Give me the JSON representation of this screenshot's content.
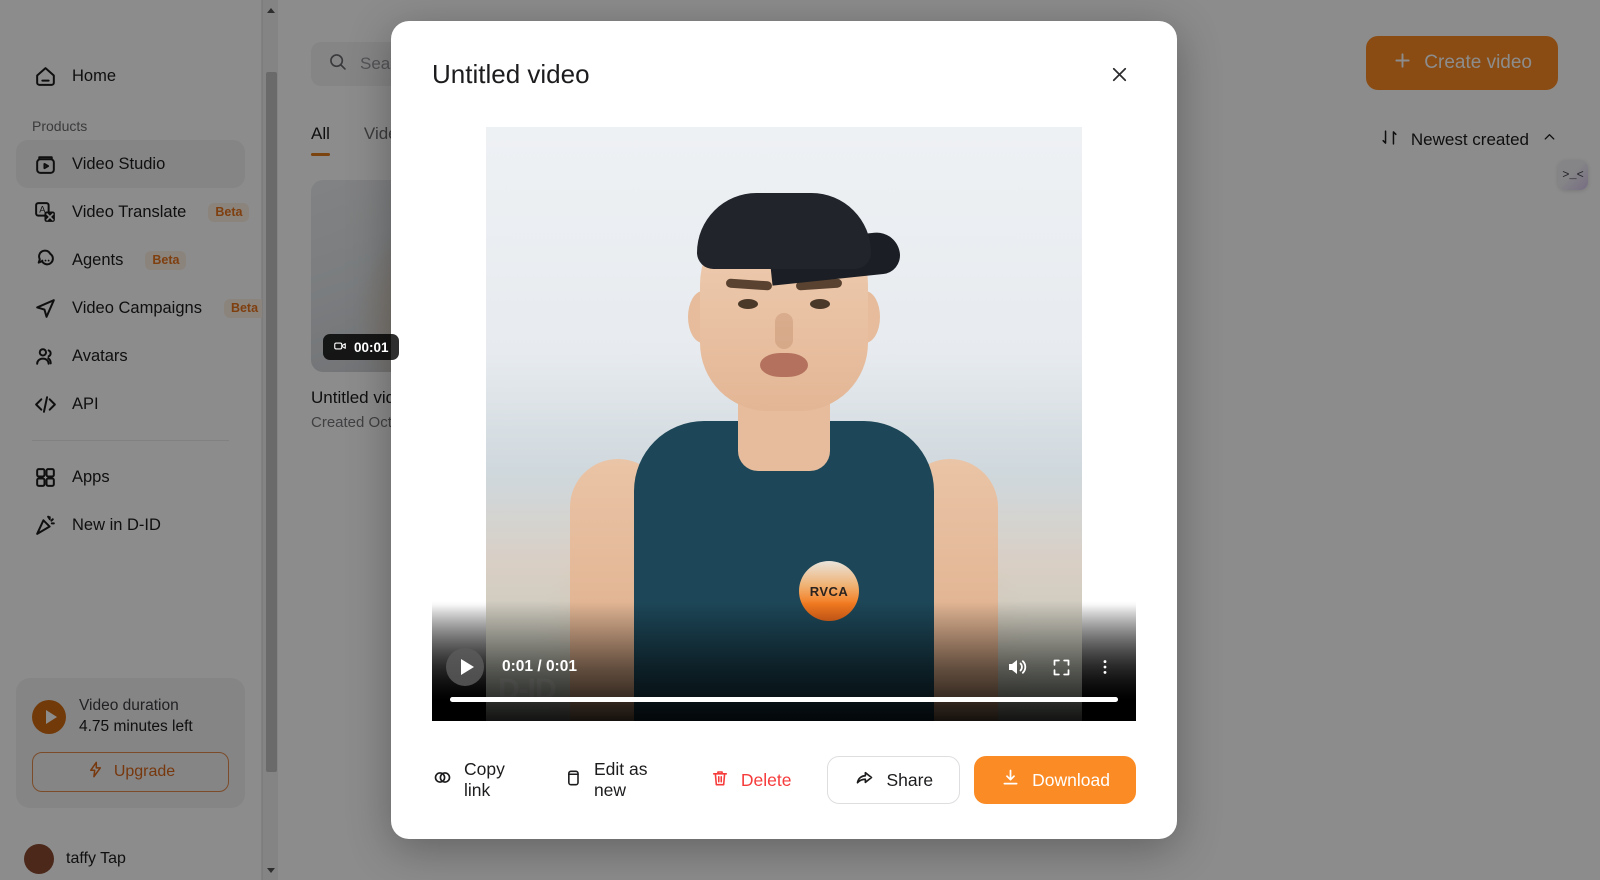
{
  "colors": {
    "accent": "#fb8b24",
    "accent_dark": "#cf6a12",
    "danger": "#f63b3b",
    "active_tab_underline": "#e07b18"
  },
  "sidebar": {
    "home": {
      "label": "Home",
      "icon": "home-icon"
    },
    "section_label": "Products",
    "items": [
      {
        "label": "Video Studio",
        "icon": "video-studio-icon",
        "badge": "",
        "active": true
      },
      {
        "label": "Video Translate",
        "icon": "video-translate-icon",
        "badge": "Beta",
        "active": false
      },
      {
        "label": "Agents",
        "icon": "agents-icon",
        "badge": "Beta",
        "active": false
      },
      {
        "label": "Video Campaigns",
        "icon": "video-campaigns-icon",
        "badge": "Beta",
        "active": false
      },
      {
        "label": "Avatars",
        "icon": "avatars-icon",
        "badge": "",
        "active": false
      },
      {
        "label": "API",
        "icon": "api-icon",
        "badge": "",
        "active": false
      }
    ],
    "items_after_divider": [
      {
        "label": "Apps",
        "icon": "apps-icon",
        "badge": ""
      },
      {
        "label": "New in D-ID",
        "icon": "confetti-icon",
        "badge": ""
      }
    ],
    "usage": {
      "title": "Video duration",
      "remaining": "4.75 minutes left",
      "upgrade_label": "Upgrade"
    },
    "user": {
      "name": "taffy Tap"
    }
  },
  "main": {
    "search_placeholder": "Search",
    "create_button": "Create video",
    "tabs": [
      {
        "label": "All",
        "active": true
      },
      {
        "label": "Videos",
        "active": false
      }
    ],
    "sort": {
      "label": "Newest created"
    },
    "cards": [
      {
        "title": "Untitled video",
        "subtitle": "Created Oct",
        "duration": "00:01"
      }
    ],
    "corner_widget": ">_<"
  },
  "modal": {
    "title": "Untitled video",
    "close_icon": "close-icon",
    "player": {
      "current_time": "0:01",
      "duration": "0:01",
      "time_display": "0:01 / 0:01",
      "progress_percent": 100,
      "watermark": "D-ID",
      "shirt_logo": "RVCA",
      "controls": [
        "play-button",
        "mute-button",
        "fullscreen-button",
        "more-options-button"
      ]
    },
    "actions": {
      "copy_link": "Copy link",
      "edit_as_new": "Edit as new",
      "delete": "Delete",
      "share": "Share",
      "download": "Download"
    }
  }
}
